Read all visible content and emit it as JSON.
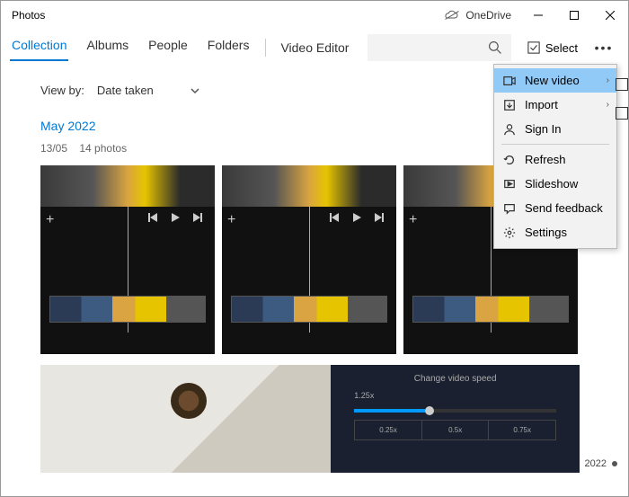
{
  "window": {
    "title": "Photos",
    "onedrive_label": "OneDrive"
  },
  "tabs": {
    "collection": "Collection",
    "albums": "Albums",
    "people": "People",
    "folders": "Folders",
    "video_editor": "Video Editor"
  },
  "toolbar": {
    "select_label": "Select"
  },
  "viewby": {
    "label": "View by:",
    "value": "Date taken"
  },
  "group": {
    "month": "May 2022",
    "date": "13/05",
    "count": "14 photos"
  },
  "speed_panel": {
    "title": "Change video speed",
    "value": "1.25x",
    "opts": [
      "0.25x",
      "0.5x",
      "0.75x"
    ]
  },
  "menu": {
    "new_video": "New video",
    "import": "Import",
    "sign_in": "Sign In",
    "refresh": "Refresh",
    "slideshow": "Slideshow",
    "send_feedback": "Send feedback",
    "settings": "Settings"
  },
  "year_marker": "2022"
}
